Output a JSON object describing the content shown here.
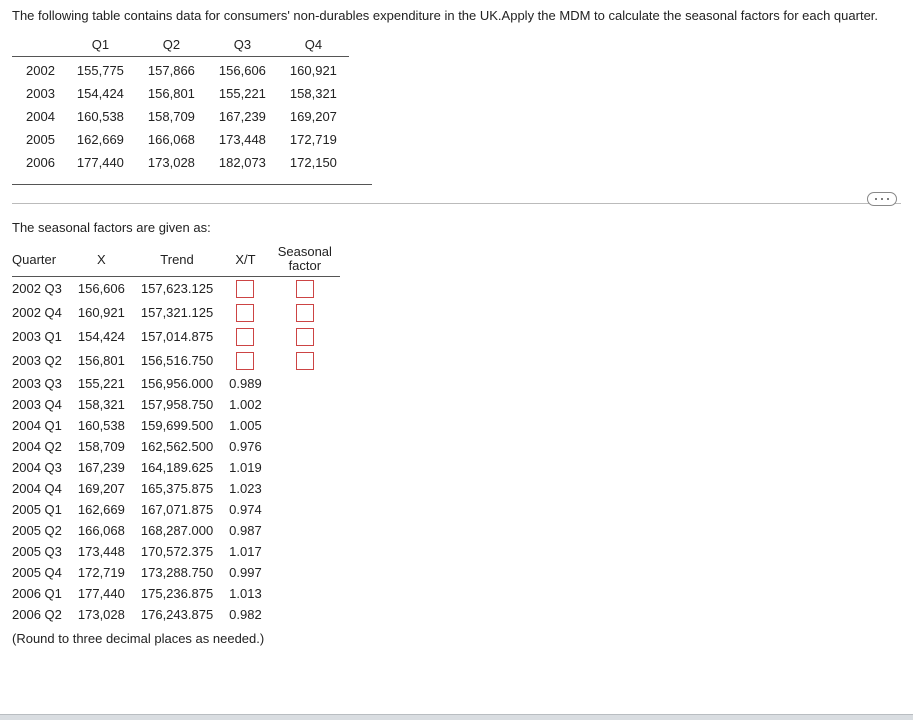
{
  "prompt": "The following table contains data for consumers' non-durables expenditure in the UK.Apply the MDM  to calculate the seasonal factors for each quarter.",
  "data_table": {
    "headers": [
      "",
      "Q1",
      "Q2",
      "Q3",
      "Q4"
    ],
    "rows": [
      {
        "year": "2002",
        "q1": "155,775",
        "q2": "157,866",
        "q3": "156,606",
        "q4": "160,921"
      },
      {
        "year": "2003",
        "q1": "154,424",
        "q2": "156,801",
        "q3": "155,221",
        "q4": "158,321"
      },
      {
        "year": "2004",
        "q1": "160,538",
        "q2": "158,709",
        "q3": "167,239",
        "q4": "169,207"
      },
      {
        "year": "2005",
        "q1": "162,669",
        "q2": "166,068",
        "q3": "173,448",
        "q4": "172,719"
      },
      {
        "year": "2006",
        "q1": "177,440",
        "q2": "173,028",
        "q3": "182,073",
        "q4": "172,150"
      }
    ]
  },
  "sf_label": "The seasonal factors are given as:",
  "sf_table": {
    "headers": {
      "quarter": "Quarter",
      "x": "X",
      "trend": "Trend",
      "xt": "X/T",
      "sf": "Seasonal factor"
    },
    "rows": [
      {
        "q": "2002 Q3",
        "x": "156,606",
        "trend": "157,623.125",
        "xt_input": true,
        "sf_input": true
      },
      {
        "q": "2002 Q4",
        "x": "160,921",
        "trend": "157,321.125",
        "xt_input": true,
        "sf_input": true
      },
      {
        "q": "2003 Q1",
        "x": "154,424",
        "trend": "157,014.875",
        "xt_input": true,
        "sf_input": true
      },
      {
        "q": "2003 Q2",
        "x": "156,801",
        "trend": "156,516.750",
        "xt_input": true,
        "sf_input": true
      },
      {
        "q": "2003 Q3",
        "x": "155,221",
        "trend": "156,956.000",
        "xt": "0.989"
      },
      {
        "q": "2003 Q4",
        "x": "158,321",
        "trend": "157,958.750",
        "xt": "1.002"
      },
      {
        "q": "2004 Q1",
        "x": "160,538",
        "trend": "159,699.500",
        "xt": "1.005"
      },
      {
        "q": "2004 Q2",
        "x": "158,709",
        "trend": "162,562.500",
        "xt": "0.976"
      },
      {
        "q": "2004 Q3",
        "x": "167,239",
        "trend": "164,189.625",
        "xt": "1.019"
      },
      {
        "q": "2004 Q4",
        "x": "169,207",
        "trend": "165,375.875",
        "xt": "1.023"
      },
      {
        "q": "2005 Q1",
        "x": "162,669",
        "trend": "167,071.875",
        "xt": "0.974"
      },
      {
        "q": "2005 Q2",
        "x": "166,068",
        "trend": "168,287.000",
        "xt": "0.987"
      },
      {
        "q": "2005 Q3",
        "x": "173,448",
        "trend": "170,572.375",
        "xt": "1.017"
      },
      {
        "q": "2005 Q4",
        "x": "172,719",
        "trend": "173,288.750",
        "xt": "0.997"
      },
      {
        "q": "2006 Q1",
        "x": "177,440",
        "trend": "175,236.875",
        "xt": "1.013"
      },
      {
        "q": "2006 Q2",
        "x": "173,028",
        "trend": "176,243.875",
        "xt": "0.982"
      }
    ]
  },
  "round_note": "(Round to three decimal places as needed.)"
}
